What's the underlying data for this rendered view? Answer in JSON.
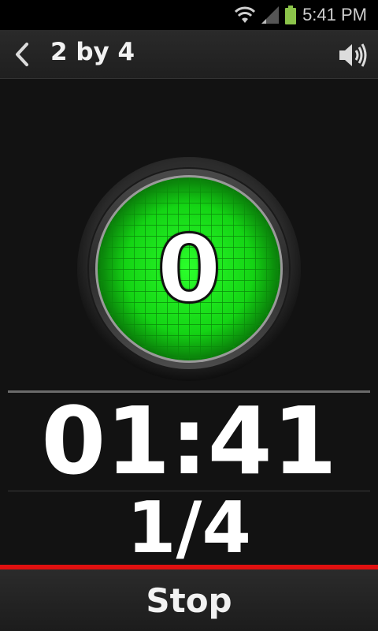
{
  "status_bar": {
    "time": "5:41 PM",
    "icons": [
      "wifi-icon",
      "signal-icon",
      "battery-icon"
    ],
    "battery_color": "#8bc34a"
  },
  "header": {
    "title": "2 by 4",
    "back_icon": "chevron-left-icon",
    "sound_icon": "speaker-icon"
  },
  "counter": {
    "value": "0",
    "indicator_color": "#1aff1a"
  },
  "timer": {
    "value": "01:41"
  },
  "progress": {
    "text": "1/4"
  },
  "footer": {
    "stop_label": "Stop",
    "accent_color": "#e01010"
  }
}
